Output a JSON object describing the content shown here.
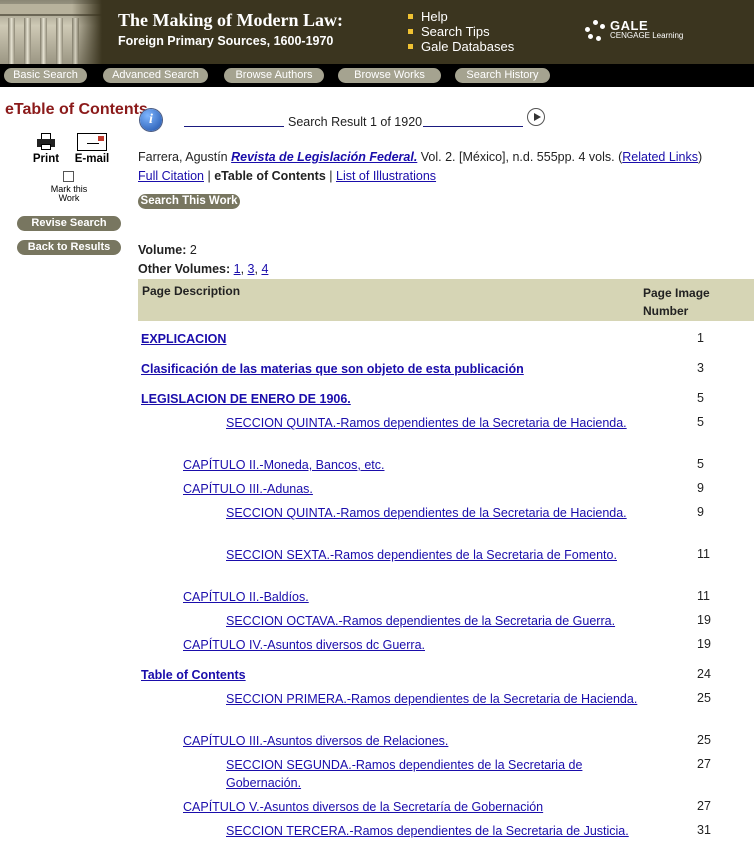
{
  "header": {
    "title": "The Making of Modern Law:",
    "subtitle": "Foreign Primary Sources, 1600-1970",
    "links": [
      "Help",
      "Search Tips",
      "Gale Databases"
    ],
    "brand_name": "GALE",
    "brand_sub": "CENGAGE Learning"
  },
  "nav": [
    "Basic Search",
    "Advanced Search",
    "Browse Authors",
    "Browse Works",
    "Search History"
  ],
  "sidebar": {
    "title": "eTable of Contents",
    "print_label": "Print",
    "email_label": "E-mail",
    "mark_label": "Mark this Work",
    "revise_label": "Revise Search",
    "back_label": "Back to Results"
  },
  "result": {
    "text": "Search Result 1 of 1920"
  },
  "citation": {
    "author": "Farrera, Agustín ",
    "work_title": "Revista de Legislación Federal.",
    "details": " Vol. 2. [México], n.d. 555pp. 4 vols. (",
    "related": "Related Links",
    "close": ")"
  },
  "view_links": {
    "full": "Full Citation",
    "sep1": " | ",
    "current": "eTable of Contents",
    "sep2": " | ",
    "illustrations": "List of Illustrations"
  },
  "search_work_label": "Search This Work",
  "volume": {
    "label": "Volume:",
    "value": "2"
  },
  "other_volumes": {
    "label": "Other Volumes:",
    "list": [
      "1",
      "3",
      "4"
    ]
  },
  "table": {
    "col_desc": "Page Description",
    "col_page": "Page Image Number",
    "rows": [
      {
        "text": "EXPLICACION",
        "page": "1"
      },
      {
        "text": "Clasificación de las materias que son objeto de esta publicación",
        "page": "3"
      },
      {
        "text": "LEGISLACION DE ENERO DE 1906.",
        "page": "5"
      },
      {
        "text": "SECCION QUINTA.-Ramos dependientes de la Secretaria de Hacienda.",
        "page": "5"
      },
      {
        "text": "CAPÍTULO II.-Moneda, Bancos, etc.",
        "page": "5"
      },
      {
        "text": "CAPÍTULO III.-Adunas.",
        "page": "9"
      },
      {
        "text": "SECCION QUINTA.-Ramos dependientes de la Secretaria de Hacienda.",
        "page": "9"
      },
      {
        "text": "SECCION SEXTA.-Ramos dependientes de la Secretaria de Fomento.",
        "page": "11"
      },
      {
        "text": "CAPÍTULO II.-Baldíos.",
        "page": "11"
      },
      {
        "text": "SECCION OCTAVA.-Ramos dependientes de la Secretaria de Guerra.",
        "page": "19"
      },
      {
        "text": "CAPÍTULO IV.-Asuntos diversos dc Guerra.",
        "page": "19"
      },
      {
        "text": "Table of Contents",
        "page": "24"
      },
      {
        "text": "SECCION PRIMERA.-Ramos dependientes de la Secretaria de Hacienda.",
        "page": "25"
      },
      {
        "text": "CAPÍTULO III.-Asuntos diversos de Relaciones.",
        "page": "25"
      },
      {
        "text": "SECCION SEGUNDA.-Ramos dependientes de la Secretaria de Gobernación.",
        "page": "27"
      },
      {
        "text": "CAPÍTULO V.-Asuntos diversos de la Secretaría de Gobernación",
        "page": "27"
      },
      {
        "text": "SECCION TERCERA.-Ramos dependientes de la Secretaria de Justicia.",
        "page": "31"
      }
    ]
  }
}
